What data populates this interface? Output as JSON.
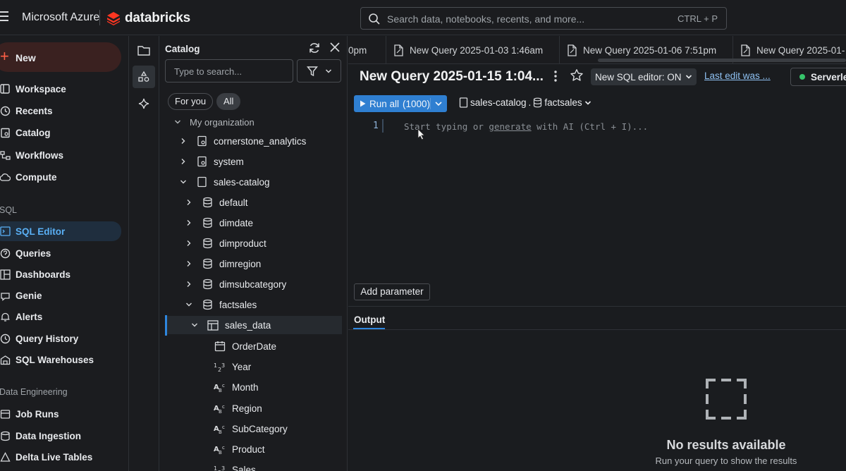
{
  "topbar": {
    "brand_ms": "Microsoft Azure",
    "brand_db": "databricks",
    "search_placeholder": "Search data, notebooks, recents, and more...",
    "search_shortcut": "CTRL + P"
  },
  "nav": {
    "new_label": "New",
    "items": [
      {
        "label": "Workspace",
        "icon": "workspace-icon"
      },
      {
        "label": "Recents",
        "icon": "clock-icon"
      },
      {
        "label": "Catalog",
        "icon": "catalog-icon"
      },
      {
        "label": "Workflows",
        "icon": "workflows-icon"
      },
      {
        "label": "Compute",
        "icon": "cloud-icon"
      }
    ],
    "sql_section": "SQL",
    "sql_items": [
      {
        "label": "SQL Editor",
        "icon": "sql-editor-icon",
        "active": true
      },
      {
        "label": "Queries",
        "icon": "queries-icon"
      },
      {
        "label": "Dashboards",
        "icon": "dashboards-icon"
      },
      {
        "label": "Genie",
        "icon": "genie-icon"
      },
      {
        "label": "Alerts",
        "icon": "bell-icon"
      },
      {
        "label": "Query History",
        "icon": "history-icon"
      },
      {
        "label": "SQL Warehouses",
        "icon": "warehouse-icon"
      }
    ],
    "de_section": "Data Engineering",
    "de_items": [
      {
        "label": "Job Runs",
        "icon": "job-runs-icon"
      },
      {
        "label": "Data Ingestion",
        "icon": "ingestion-icon"
      },
      {
        "label": "Delta Live Tables",
        "icon": "dlt-icon"
      }
    ]
  },
  "catalog": {
    "title": "Catalog",
    "search_placeholder": "Type to search...",
    "pill_for_you": "For you",
    "pill_all": "All",
    "org_label": "My organization",
    "catalogs": [
      "cornerstone_analytics",
      "system",
      "sales-catalog"
    ],
    "schemas": [
      "default",
      "dimdate",
      "dimproduct",
      "dimregion",
      "dimsubcategory",
      "factsales"
    ],
    "table": "sales_data",
    "columns": [
      {
        "name": "OrderDate",
        "type": "date"
      },
      {
        "name": "Year",
        "type": "numeric"
      },
      {
        "name": "Month",
        "type": "string"
      },
      {
        "name": "Region",
        "type": "string"
      },
      {
        "name": "SubCategory",
        "type": "string"
      },
      {
        "name": "Product",
        "type": "string"
      },
      {
        "name": "Sales",
        "type": "numeric"
      }
    ]
  },
  "tabs": [
    {
      "label": "0pm"
    },
    {
      "label": "New Query 2025-01-03 1:46am"
    },
    {
      "label": "New Query 2025-01-06 7:51pm"
    },
    {
      "label": "New Query 2025-01-"
    }
  ],
  "editor": {
    "title": "New Query 2025-01-15 1:04...",
    "sql_toggle": "New SQL editor: ON",
    "last_edit": "Last edit was ...",
    "warehouse": "Serverles",
    "run_label": "Run all",
    "run_limit": "(1000)",
    "ctx_catalog": "sales-catalog",
    "ctx_dot": ".",
    "ctx_schema": "factsales",
    "line_number": "1",
    "placeholder_a": "Start typing or ",
    "placeholder_link": "generate",
    "placeholder_b": " with AI (Ctrl + I)...",
    "add_parameter": "Add parameter"
  },
  "output": {
    "tab_label": "Output",
    "empty_title": "No results available",
    "empty_sub": "Run your query to show the results"
  },
  "colors": {
    "accent": "#2f7fd1",
    "brand": "#ff3621",
    "status_green": "#36c46b"
  }
}
